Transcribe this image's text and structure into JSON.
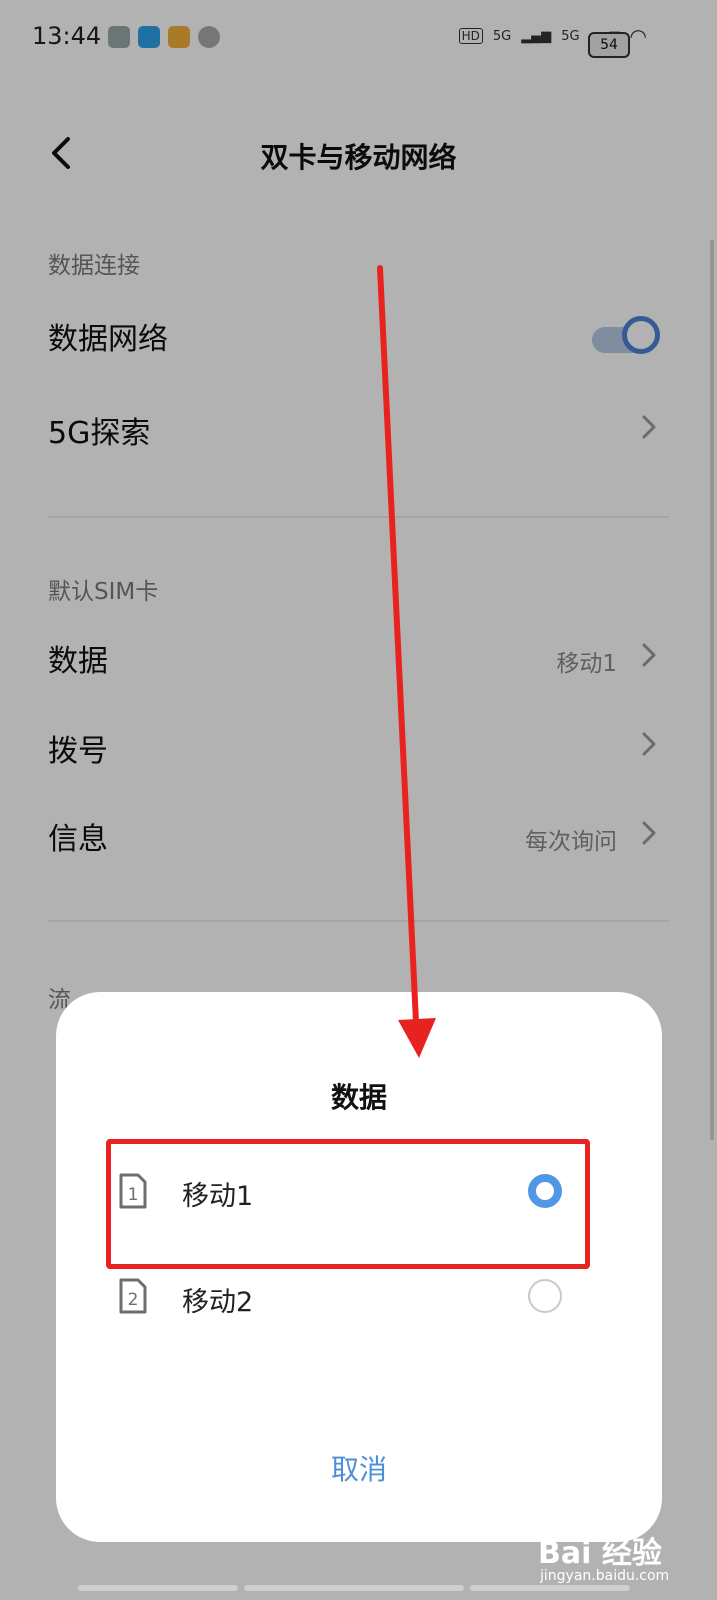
{
  "status_bar": {
    "time": "13:44",
    "network_1": "5G",
    "network_2": "5G",
    "hd_label": "HD",
    "battery": "54"
  },
  "header": {
    "title": "双卡与移动网络"
  },
  "sections": {
    "data_connection": {
      "header": "数据连接",
      "data_network_label": "数据网络",
      "data_network_enabled": true,
      "fiveg_label": "5G探索"
    },
    "default_sim": {
      "header": "默认SIM卡",
      "rows": [
        {
          "label": "数据",
          "value": "移动1"
        },
        {
          "label": "拨号",
          "value": ""
        },
        {
          "label": "信息",
          "value": "每次询问"
        }
      ]
    },
    "traffic": {
      "header": "流"
    }
  },
  "dialog": {
    "title": "数据",
    "options": [
      {
        "sim_number": "1",
        "label": "移动1",
        "selected": true
      },
      {
        "sim_number": "2",
        "label": "移动2",
        "selected": false
      }
    ],
    "cancel_label": "取消"
  },
  "watermark": {
    "text": "Bai 经验",
    "sub": "jingyan.baidu.com"
  },
  "colors": {
    "accent": "#4c8fd8",
    "highlight": "#e8231f",
    "overlay": "rgba(0,0,0,0.30)"
  }
}
